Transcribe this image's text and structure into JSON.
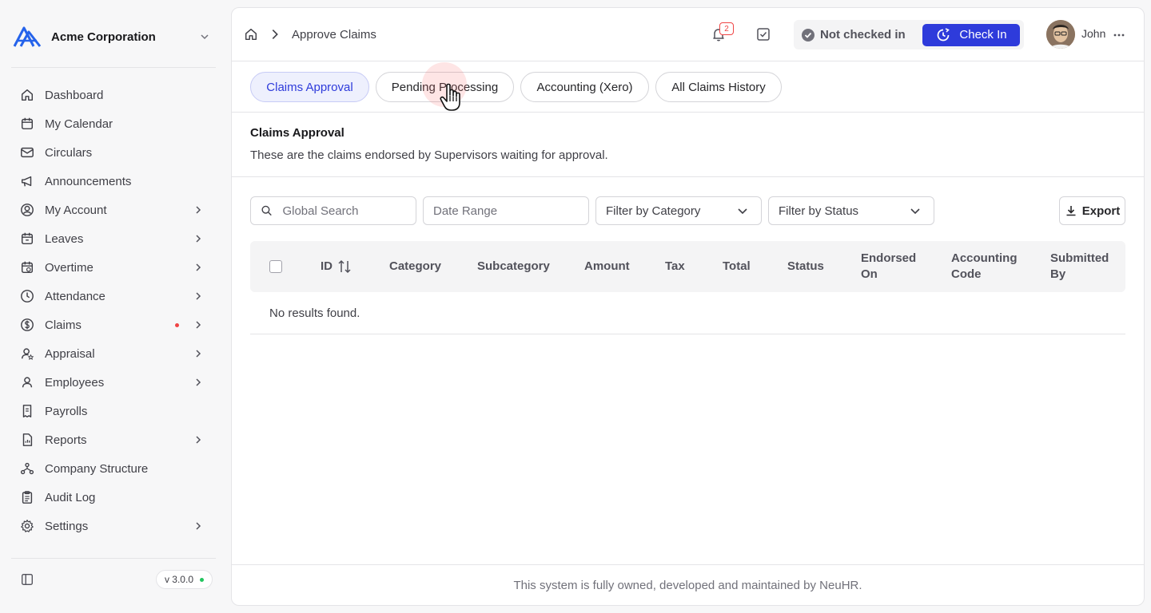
{
  "org": {
    "name": "Acme Corporation"
  },
  "sidebar": {
    "items": [
      {
        "label": "Dashboard",
        "icon": "home-icon",
        "chevron": false
      },
      {
        "label": "My Calendar",
        "icon": "calendar-icon",
        "chevron": false
      },
      {
        "label": "Circulars",
        "icon": "mail-icon",
        "chevron": false
      },
      {
        "label": "Announcements",
        "icon": "megaphone-icon",
        "chevron": false
      },
      {
        "label": "My Account",
        "icon": "user-circle-icon",
        "chevron": true
      },
      {
        "label": "Leaves",
        "icon": "calendar-leave-icon",
        "chevron": true
      },
      {
        "label": "Overtime",
        "icon": "calendar-clock-icon",
        "chevron": true
      },
      {
        "label": "Attendance",
        "icon": "clock-icon",
        "chevron": true
      },
      {
        "label": "Claims",
        "icon": "dollar-circle-icon",
        "chevron": true,
        "dot": true
      },
      {
        "label": "Appraisal",
        "icon": "user-star-icon",
        "chevron": true
      },
      {
        "label": "Employees",
        "icon": "user-icon",
        "chevron": true
      },
      {
        "label": "Payrolls",
        "icon": "receipt-icon",
        "chevron": false
      },
      {
        "label": "Reports",
        "icon": "report-icon",
        "chevron": true
      },
      {
        "label": "Company Structure",
        "icon": "org-chart-icon",
        "chevron": false
      },
      {
        "label": "Audit Log",
        "icon": "clipboard-icon",
        "chevron": false
      },
      {
        "label": "Settings",
        "icon": "gear-icon",
        "chevron": true
      }
    ],
    "version": "v 3.0.0"
  },
  "header": {
    "breadcrumb": "Approve Claims",
    "notification_count": "2",
    "status_text": "Not checked in",
    "checkin_label": "Check In",
    "user_name": "John"
  },
  "tabs": [
    {
      "label": "Claims Approval",
      "active": true
    },
    {
      "label": "Pending Processing",
      "active": false
    },
    {
      "label": "Accounting (Xero)",
      "active": false
    },
    {
      "label": "All Claims History",
      "active": false
    }
  ],
  "section": {
    "title": "Claims Approval",
    "description": "These are the claims endorsed by Supervisors waiting for approval."
  },
  "filters": {
    "search_placeholder": "Global Search",
    "date_placeholder": "Date Range",
    "category_label": "Filter by Category",
    "status_label": "Filter by Status",
    "export_label": "Export"
  },
  "table": {
    "columns": [
      "ID",
      "Category",
      "Subcategory",
      "Amount",
      "Tax",
      "Total",
      "Status",
      "Endorsed On",
      "Accounting Code",
      "Submitted By"
    ],
    "empty_message": "No results found."
  },
  "footer": {
    "text": "This system is fully owned, developed and maintained by NeuHR."
  },
  "colors": {
    "accent": "#2e3bdb",
    "badge": "#ef4444",
    "online": "#22c55e"
  }
}
